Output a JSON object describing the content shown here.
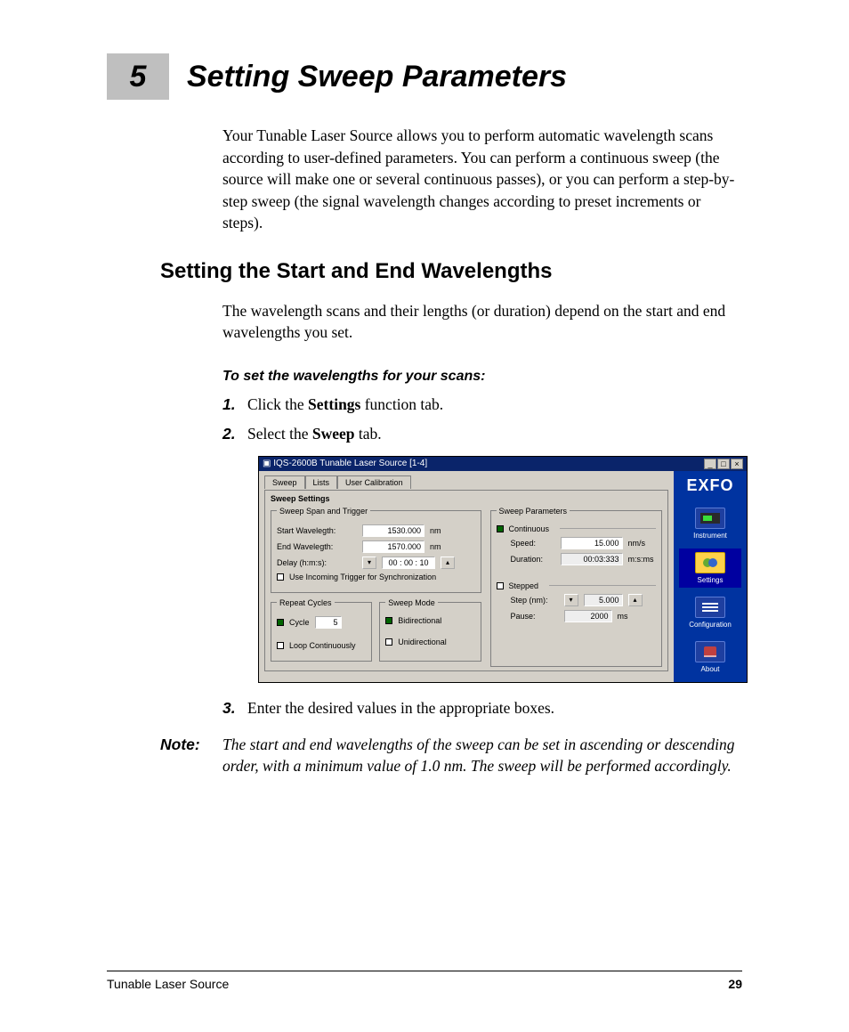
{
  "chapter": {
    "number": "5",
    "title": "Setting Sweep Parameters"
  },
  "intro": "Your Tunable Laser Source allows you to perform automatic wavelength scans according to user-defined parameters. You can perform a continuous sweep (the source will make one or several continuous passes), or you can perform a step-by-step sweep (the signal wavelength changes according to preset increments or steps).",
  "section_h2": "Setting the Start and End Wavelengths",
  "section_intro": "The wavelength scans and their lengths (or duration) depend on the start and end wavelengths you set.",
  "proc_head": "To set the wavelengths for your scans:",
  "steps": {
    "s1_num": "1.",
    "s1_a": "Click the ",
    "s1_b": "Settings",
    "s1_c": " function tab.",
    "s2_num": "2.",
    "s2_a": "Select the ",
    "s2_b": "Sweep",
    "s2_c": " tab.",
    "s3_num": "3.",
    "s3": "Enter the desired values in the appropriate boxes."
  },
  "note": {
    "label": "Note:",
    "body": "The start and end wavelengths of the sweep can be set in ascending or descending order, with a minimum value of 1.0 nm. The sweep will be performed accordingly."
  },
  "footer": {
    "doc": "Tunable Laser Source",
    "page": "29"
  },
  "fig": {
    "title": "IQS-2600B Tunable Laser Source [1-4]",
    "tabs": {
      "sweep": "Sweep",
      "lists": "Lists",
      "cal": "User Calibration"
    },
    "settings_title": "Sweep Settings",
    "span": {
      "legend": "Sweep Span and Trigger",
      "start_lbl": "Start Wavelegth:",
      "start_val": "1530.000",
      "end_lbl": "End Wavelegth:",
      "end_val": "1570.000",
      "nm": "nm",
      "delay_lbl": "Delay (h:m:s):",
      "delay_val": "00 : 00 : 10",
      "trigger": "Use Incoming Trigger for Synchronization"
    },
    "repeat": {
      "legend": "Repeat Cycles",
      "cycle": "Cycle",
      "cycle_val": "5",
      "loop": "Loop Continuously"
    },
    "mode": {
      "legend": "Sweep Mode",
      "bi": "Bidirectional",
      "uni": "Unidirectional"
    },
    "params": {
      "legend": "Sweep Parameters",
      "continuous": "Continuous",
      "speed_lbl": "Speed:",
      "speed_val": "15.000",
      "speed_unit": "nm/s",
      "dur_lbl": "Duration:",
      "dur_val": "00:03:333",
      "dur_unit": "m:s:ms",
      "stepped": "Stepped",
      "step_lbl": "Step (nm):",
      "step_val": "5.000",
      "pause_lbl": "Pause:",
      "pause_val": "2000",
      "pause_unit": "ms"
    },
    "sidebar": {
      "logo": "EXFO",
      "instrument": "Instrument",
      "settings": "Settings",
      "config": "Configuration",
      "about": "About"
    },
    "winbtns": {
      "min": "_",
      "max": "□",
      "close": "×"
    }
  }
}
